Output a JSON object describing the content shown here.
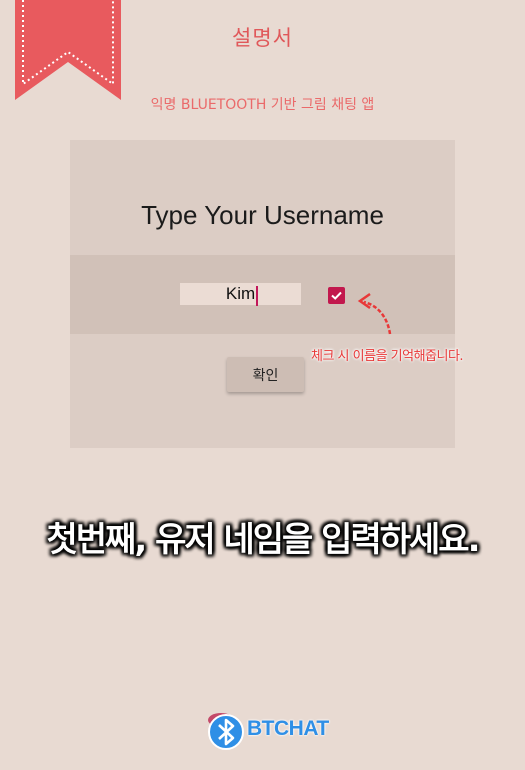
{
  "header": {
    "title": "설명서",
    "subtitle": "익명 BLUETOOTH 기반 그림 채팅 앱"
  },
  "login": {
    "prompt": "Type Your Username",
    "username_value": "Kim",
    "remember_checked": true,
    "confirm_label": "확인"
  },
  "hint": {
    "text": "체크 시 이름을 기억해줍니다."
  },
  "caption": {
    "text": "첫번째, 유저 네임을 입력하세요."
  },
  "footer": {
    "brand": "BTCHAT"
  },
  "colors": {
    "background": "#e8dad2",
    "accent": "#e0585a",
    "checkbox": "#c2184d",
    "brand_blue": "#2f8fe6"
  }
}
